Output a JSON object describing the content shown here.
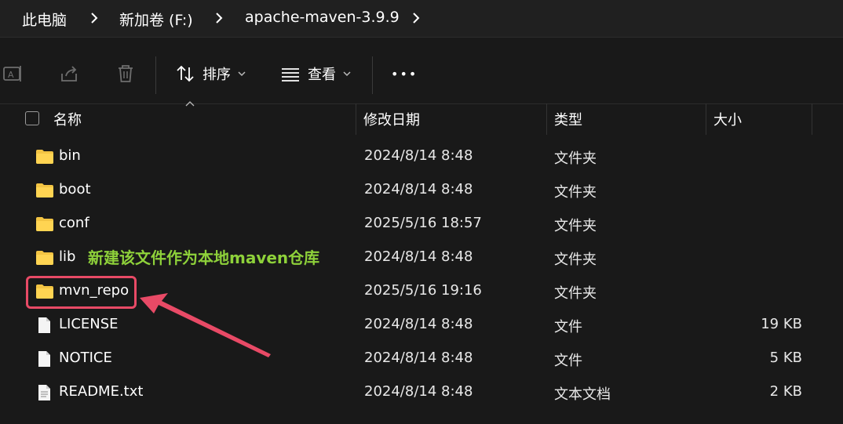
{
  "breadcrumb": {
    "items": [
      "此电脑",
      "新加卷 (F:)",
      "apache-maven-3.9.9"
    ]
  },
  "toolbar": {
    "sort_label": "排序",
    "view_label": "查看",
    "more_label": "•••",
    "icons": [
      "rename-icon",
      "share-icon",
      "delete-icon",
      "sort-icon",
      "chevron-down-icon",
      "view-icon",
      "chevron-down-icon",
      "more-icon"
    ]
  },
  "columns": {
    "name": "名称",
    "modified": "修改日期",
    "type": "类型",
    "size": "大小"
  },
  "files": [
    {
      "name": "bin",
      "modified": "2024/8/14 8:48",
      "type": "文件夹",
      "size": "",
      "icon": "folder-icon"
    },
    {
      "name": "boot",
      "modified": "2024/8/14 8:48",
      "type": "文件夹",
      "size": "",
      "icon": "folder-icon"
    },
    {
      "name": "conf",
      "modified": "2025/5/16 18:57",
      "type": "文件夹",
      "size": "",
      "icon": "folder-icon"
    },
    {
      "name": "lib",
      "modified": "2024/8/14 8:48",
      "type": "文件夹",
      "size": "",
      "icon": "folder-icon"
    },
    {
      "name": "mvn_repo",
      "modified": "2025/5/16 19:16",
      "type": "文件夹",
      "size": "",
      "icon": "folder-icon"
    },
    {
      "name": "LICENSE",
      "modified": "2024/8/14 8:48",
      "type": "文件",
      "size": "19 KB",
      "icon": "file-icon"
    },
    {
      "name": "NOTICE",
      "modified": "2024/8/14 8:48",
      "type": "文件",
      "size": "5 KB",
      "icon": "file-icon"
    },
    {
      "name": "README.txt",
      "modified": "2024/8/14 8:48",
      "type": "文本文档",
      "size": "2 KB",
      "icon": "text-file-icon"
    }
  ],
  "annotation": {
    "text": "新建该文件作为本地maven仓库",
    "color": "#8ed13a",
    "highlight_color": "#e84a66"
  },
  "colors": {
    "background": "#191919",
    "crumb_bar": "#202020",
    "folder": "#f3c443"
  }
}
